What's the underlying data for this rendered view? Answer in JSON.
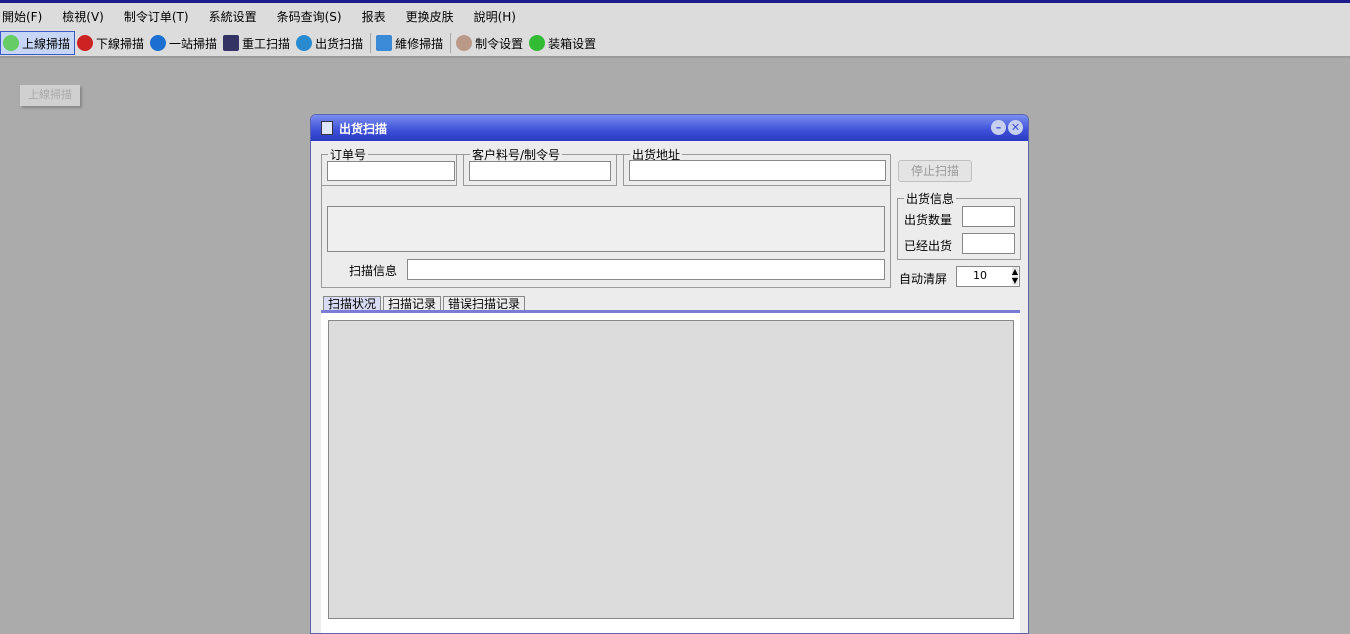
{
  "menu": [
    "開始(F)",
    "檢視(V)",
    "制令订单(T)",
    "系統设置",
    "条码查询(S)",
    "报表",
    "更换皮肤",
    "說明(H)"
  ],
  "toolbar": [
    "上線掃描",
    "下線掃描",
    "一站掃描",
    "重工扫描",
    "出货扫描",
    "維修掃描",
    "制令设置",
    "装箱设置"
  ],
  "ghost_button": "上線掃描",
  "dialog": {
    "title": "出货扫描",
    "order_label": "订单号",
    "customer_label": "客户料号/制令号",
    "address_label": "出货地址",
    "scan_info_label": "扫描信息",
    "stop_button": "停止扫描",
    "ship_info_label": "出货信息",
    "ship_qty_label": "出货数量",
    "shipped_label": "已经出货",
    "auto_clear_label": "自动清屏",
    "auto_clear_value": "10",
    "tabs": [
      "扫描状况",
      "扫描记录",
      "错误扫描记录"
    ]
  }
}
